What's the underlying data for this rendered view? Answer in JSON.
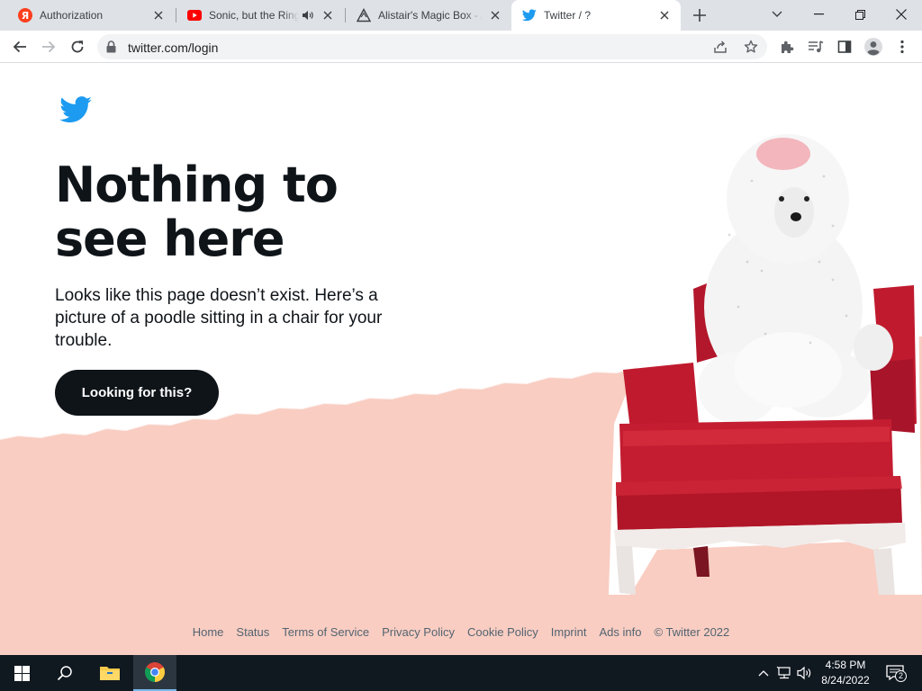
{
  "browser": {
    "tabs": [
      {
        "title": "Authorization",
        "icon": "yandex-icon",
        "active": false
      },
      {
        "title": "Sonic, but the Ring",
        "icon": "youtube-icon",
        "active": false,
        "audio": true
      },
      {
        "title": "Alistair's Magic Box - A",
        "icon": "alistair-icon",
        "active": false
      },
      {
        "title": "Twitter / ?",
        "icon": "twitter-icon",
        "active": true
      }
    ],
    "url": "twitter.com/login"
  },
  "page": {
    "headline_line1": "Nothing to",
    "headline_line2": "see here",
    "subtext": "Looks like this page doesn’t exist. Here’s a picture of a poodle sitting in a chair for your trouble.",
    "cta_label": "Looking for this?",
    "footer_links": [
      "Home",
      "Status",
      "Terms of Service",
      "Privacy Policy",
      "Cookie Policy",
      "Imprint",
      "Ads info",
      "© Twitter 2022"
    ]
  },
  "taskbar": {
    "time": "4:58 PM",
    "date": "8/24/2022",
    "notification_count": "2"
  },
  "colors": {
    "twitter_blue": "#1d9bf0",
    "pink_background": "#f9cdc2",
    "chair_red": "#c01a2e",
    "button_black": "#0f1419"
  }
}
